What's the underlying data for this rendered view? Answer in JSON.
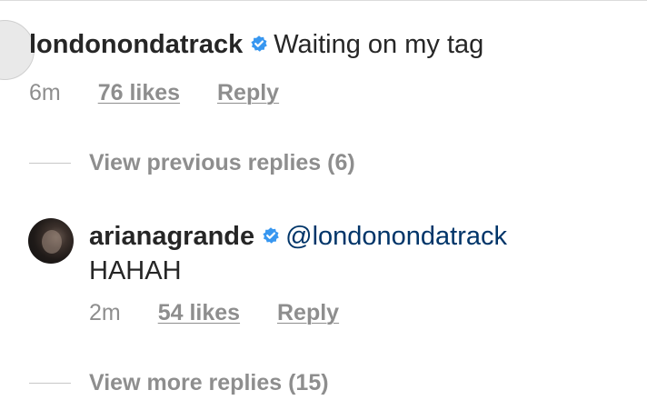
{
  "comment": {
    "username": "londonondatrack",
    "text": "Waiting on my tag",
    "time": "6m",
    "likes": "76 likes",
    "reply_label": "Reply"
  },
  "previous_replies": {
    "label": "View previous replies (6)"
  },
  "reply": {
    "username": "arianagrande",
    "mention": "@londonondatrack",
    "text": "HAHAH",
    "time": "2m",
    "likes": "54 likes",
    "reply_label": "Reply"
  },
  "more_replies": {
    "label": "View more replies (15)"
  },
  "colors": {
    "verified_badge": "#3897f0",
    "meta_text": "#8e8e8e",
    "body_text": "#262626",
    "mention": "#003569"
  },
  "icons": {
    "verified": "verified-badge-icon"
  }
}
